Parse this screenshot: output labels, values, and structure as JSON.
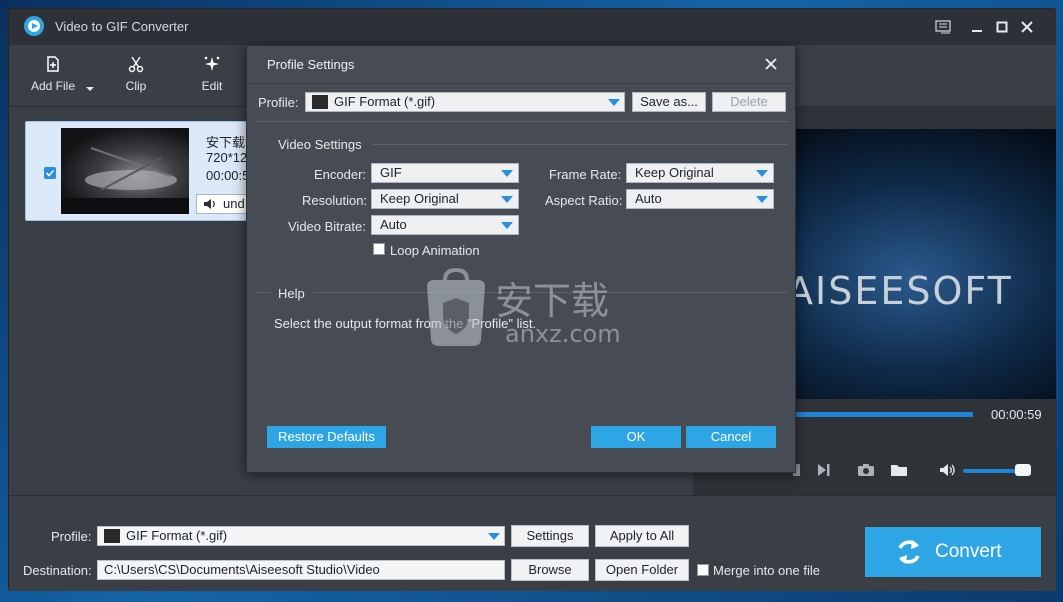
{
  "app": {
    "title": "Video to GIF Converter"
  },
  "toolbar": {
    "add_file": "Add File",
    "clip": "Clip",
    "edit": "Edit"
  },
  "file": {
    "name": "安下载.",
    "resolution": "720*12",
    "duration": "00:00:5",
    "audio": "und"
  },
  "preview": {
    "brand": "AISEESOFT",
    "total_time": "00:00:59"
  },
  "bottom": {
    "profile_label": "Profile:",
    "profile_value": "GIF Format (*.gif)",
    "settings_label": "Settings",
    "apply_all_label": "Apply to All",
    "destination_label": "Destination:",
    "destination_value": "C:\\Users\\CS\\Documents\\Aiseesoft Studio\\Video",
    "browse_label": "Browse",
    "open_folder_label": "Open Folder",
    "merge_label": "Merge into one file",
    "convert_label": "Convert"
  },
  "dialog": {
    "title": "Profile Settings",
    "profile_label": "Profile:",
    "profile_value": "GIF Format (*.gif)",
    "save_as_label": "Save as...",
    "delete_label": "Delete",
    "video_settings_title": "Video Settings",
    "encoder_label": "Encoder:",
    "encoder_value": "GIF",
    "resolution_label": "Resolution:",
    "resolution_value": "Keep Original",
    "bitrate_label": "Video Bitrate:",
    "bitrate_value": "Auto",
    "framerate_label": "Frame Rate:",
    "framerate_value": "Keep Original",
    "aspect_label": "Aspect Ratio:",
    "aspect_value": "Auto",
    "loop_label": "Loop Animation",
    "help_title": "Help",
    "help_text": "Select the output format from the \"Profile\" list.",
    "restore_label": "Restore Defaults",
    "ok_label": "OK",
    "cancel_label": "Cancel",
    "watermark_text": "安下载",
    "watermark_url": "anxz.com"
  },
  "colors": {
    "accent": "#2ea6e6",
    "window_bg": "#3a3f46",
    "dialog_bg": "#474c54"
  },
  "icons": [
    "app-logo-icon",
    "menu-icon",
    "minimize-icon",
    "maximize-icon",
    "close-icon",
    "add-file-icon",
    "dropdown-arrow-icon",
    "scissors-icon",
    "sparkle-edit-icon",
    "speaker-icon",
    "stop-icon",
    "next-frame-icon",
    "camera-icon",
    "folder-icon",
    "volume-icon",
    "convert-refresh-icon",
    "gif-film-icon"
  ]
}
